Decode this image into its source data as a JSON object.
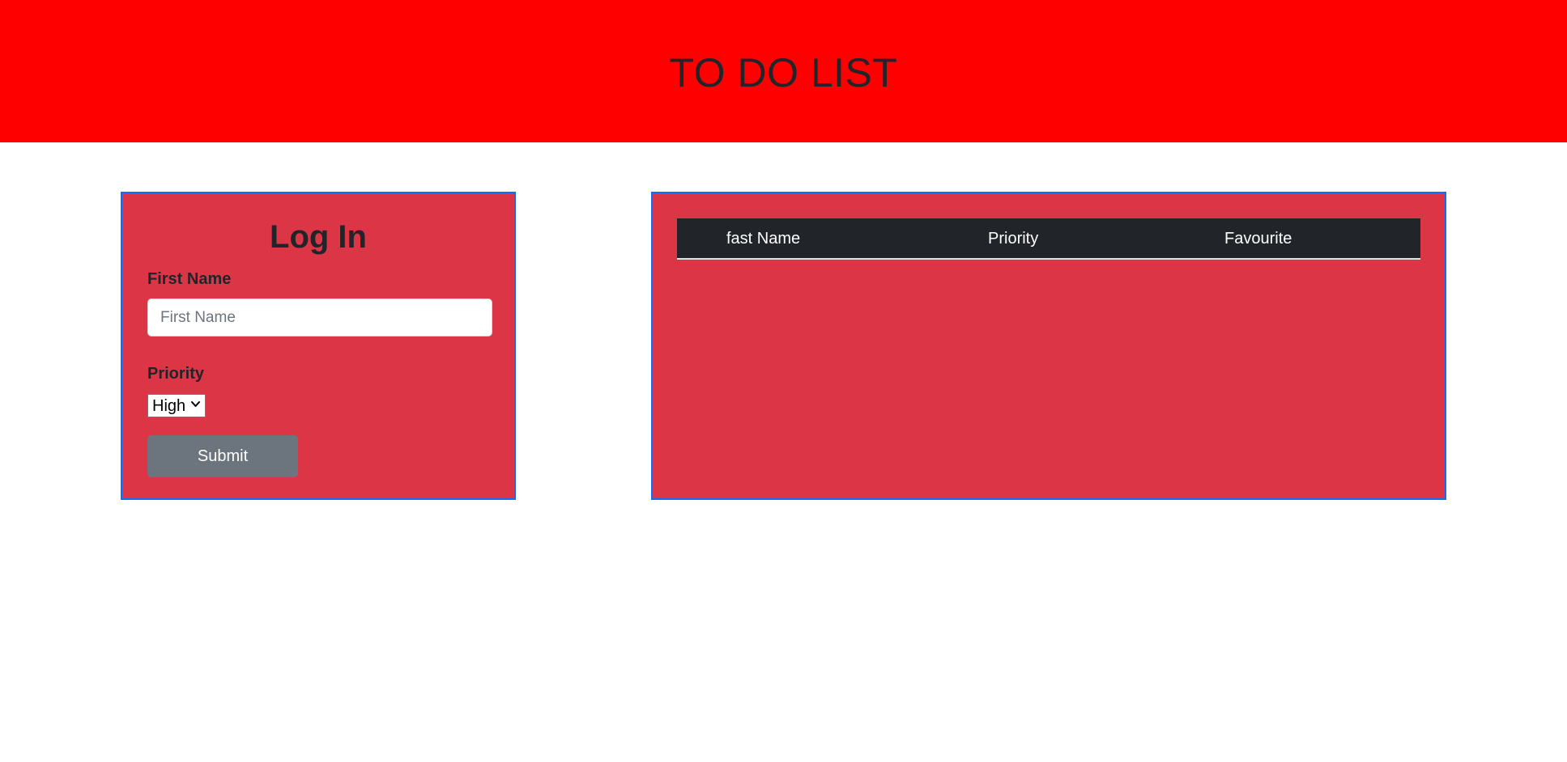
{
  "header": {
    "title": "TO DO LIST"
  },
  "login": {
    "title": "Log In",
    "first_name_label": "First Name",
    "first_name_placeholder": "First Name",
    "first_name_value": "",
    "priority_label": "Priority",
    "priority_selected": "High",
    "submit_label": "Submit"
  },
  "table": {
    "columns": [
      "fast Name",
      "Priority",
      "Favourite"
    ],
    "rows": []
  },
  "colors": {
    "header_bg": "#ff0000",
    "card_bg": "#dc3545",
    "card_border": "#0d6efd",
    "table_head_bg": "#212529",
    "button_bg": "#6c757d"
  },
  "icons": {
    "select_arrow": "chevron-down-icon"
  }
}
